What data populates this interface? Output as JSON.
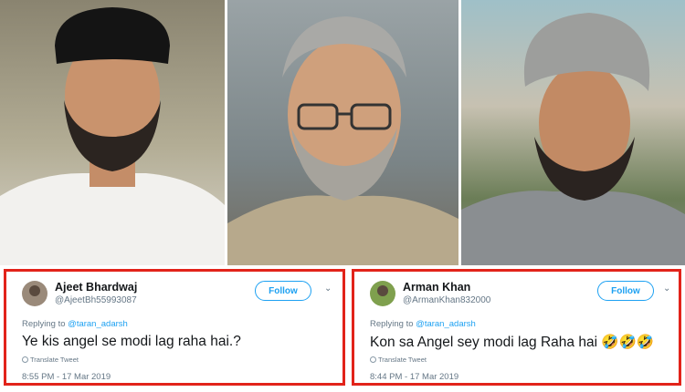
{
  "photos": [
    {
      "subject": "man-in-black-cap-and-white-kurta"
    },
    {
      "subject": "man-with-glasses-and-grey-beard"
    },
    {
      "subject": "man-in-grey-turban"
    }
  ],
  "colors": {
    "frame": "#e2231a",
    "accent": "#1da1f2",
    "muted": "#657786"
  },
  "tweets": [
    {
      "name": "Ajeet Bhardwaj",
      "handle": "@AjeetBh55993087",
      "follow_label": "Follow",
      "chevron": "⌄",
      "replying_prefix": "Replying to",
      "mention": "@taran_adarsh",
      "text": "Ye kis angel se modi lag raha hai.?",
      "translate_label": "Translate Tweet",
      "timestamp": "8:55 PM - 17 Mar 2019"
    },
    {
      "name": "Arman Khan",
      "handle": "@ArmanKhan832000",
      "follow_label": "Follow",
      "chevron": "⌄",
      "replying_prefix": "Replying to",
      "mention": "@taran_adarsh",
      "text": "Kon sa Angel sey modi lag Raha hai 🤣🤣🤣",
      "translate_label": "Translate Tweet",
      "timestamp": "8:44 PM - 17 Mar 2019"
    }
  ]
}
